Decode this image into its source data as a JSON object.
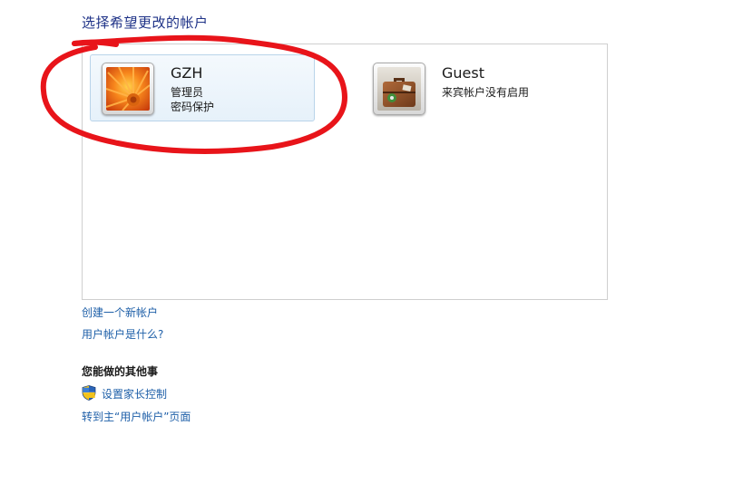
{
  "header": {
    "title": "选择希望更改的帐户"
  },
  "accounts": [
    {
      "name": "GZH",
      "line1": "管理员",
      "line2": "密码保护"
    },
    {
      "name": "Guest",
      "line1": "来宾帐户没有启用",
      "line2": ""
    }
  ],
  "links": {
    "create": "创建一个新帐户",
    "what_is": "用户帐户是什么?"
  },
  "other": {
    "heading": "您能做的其他事",
    "parental": "设置家长控制",
    "goto_main": "转到主“用户帐户”页面"
  },
  "icons": {
    "gzh_avatar": "orange-flower-picture",
    "guest_avatar": "suitcase-picture",
    "parental": "uac-shield-icon"
  },
  "colors": {
    "title": "#1e3287",
    "link": "#1e5fa8",
    "annotation": "#e8141a"
  }
}
